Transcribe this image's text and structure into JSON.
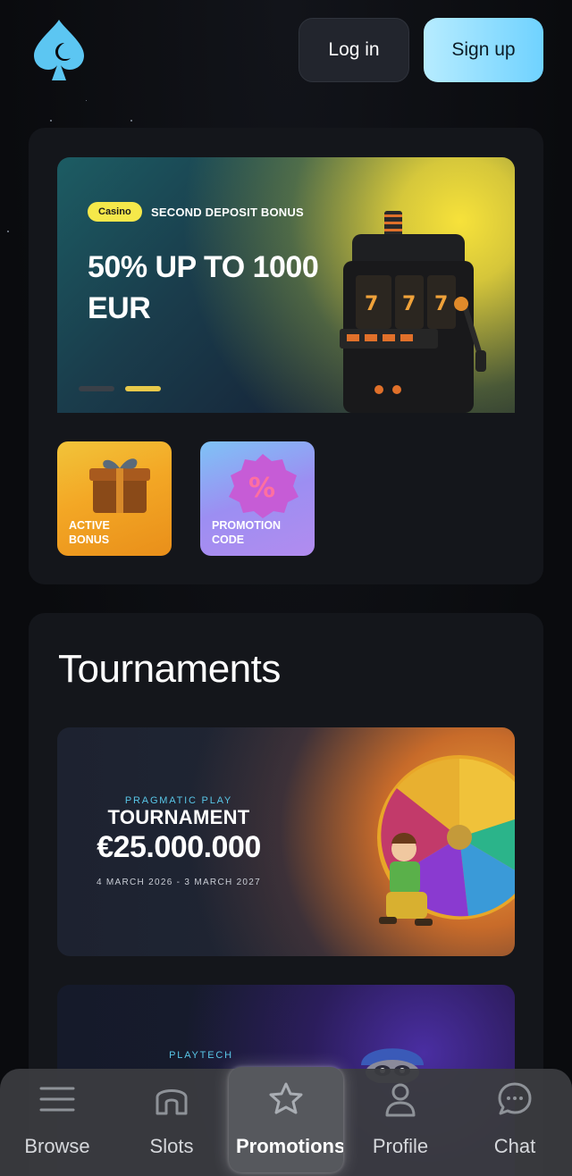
{
  "header": {
    "login_label": "Log in",
    "signup_label": "Sign up"
  },
  "promo": {
    "tag": "Casino",
    "subtitle": "SECOND DEPOSIT BONUS",
    "title": "50% UP TO 1000 EUR",
    "active_slide": 2,
    "slide_count": 2
  },
  "quick_tiles": [
    {
      "label": "ACTIVE\nBONUS"
    },
    {
      "label": "PROMOTION\nCODE"
    }
  ],
  "tournaments": {
    "heading": "Tournaments",
    "items": [
      {
        "provider": "PRAGMATIC PLAY",
        "title": "TOURNAMENT",
        "prize": "€25.000.000",
        "dates": "4 MARCH 2026 - 3 MARCH 2027"
      },
      {
        "provider": "PLAYTECH"
      }
    ]
  },
  "nav": {
    "items": [
      {
        "label": "Browse",
        "icon": "menu-icon"
      },
      {
        "label": "Slots",
        "icon": "home-icon"
      },
      {
        "label": "Promotions",
        "icon": "star-icon",
        "active": true
      },
      {
        "label": "Profile",
        "icon": "user-icon"
      },
      {
        "label": "Chat",
        "icon": "chat-icon"
      }
    ]
  },
  "colors": {
    "background": "#0a0b0e",
    "card": "#14161b",
    "accent": "#6fd2ff",
    "tag_yellow": "#f5e84a"
  }
}
